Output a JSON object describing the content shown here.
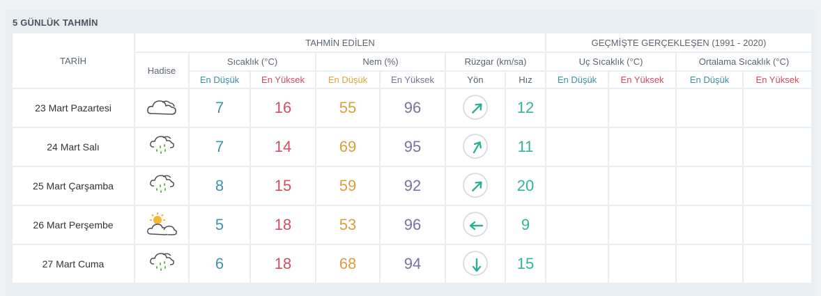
{
  "header": {
    "title": "5 GÜNLÜK TAHMİN"
  },
  "table": {
    "col_date": "TARİH",
    "col_forecast": "TAHMİN EDİLEN",
    "col_past": "GEÇMİŞTE GERÇEKLEŞEN (1991 - 2020)",
    "col_event": "Hadise",
    "col_temp": "Sıcaklık (°C)",
    "col_hum": "Nem (%)",
    "col_wind": "Rüzgar (km/sa)",
    "col_extreme": "Uç Sıcaklık (°C)",
    "col_avg": "Ortalama Sıcaklık (°C)",
    "sub_low": "En Düşük",
    "sub_high": "En Yüksek",
    "sub_dir": "Yön",
    "sub_speed": "Hız"
  },
  "rows": [
    {
      "date": "23 Mart Pazartesi",
      "icon": "cloudy-icon",
      "tmin": "7",
      "tmax": "16",
      "hmin": "55",
      "hmax": "96",
      "wind_dir": "southwest",
      "wind_deg": 225,
      "wind_speed": "12"
    },
    {
      "date": "24 Mart Salı",
      "icon": "rain-icon",
      "tmin": "7",
      "tmax": "14",
      "hmin": "69",
      "hmax": "95",
      "wind_dir": "southwest",
      "wind_deg": 210,
      "wind_speed": "11"
    },
    {
      "date": "25 Mart Çarşamba",
      "icon": "rain-icon",
      "tmin": "8",
      "tmax": "15",
      "hmin": "59",
      "hmax": "92",
      "wind_dir": "southwest",
      "wind_deg": 225,
      "wind_speed": "20"
    },
    {
      "date": "26 Mart Perşembe",
      "icon": "partly-cloudy-icon",
      "tmin": "5",
      "tmax": "18",
      "hmin": "53",
      "hmax": "96",
      "wind_dir": "east",
      "wind_deg": 90,
      "wind_speed": "9"
    },
    {
      "date": "27 Mart Cuma",
      "icon": "rain-icon",
      "tmin": "6",
      "tmax": "18",
      "hmin": "68",
      "hmax": "94",
      "wind_dir": "north",
      "wind_deg": 0,
      "wind_speed": "15"
    }
  ],
  "colors": {
    "low": "#3f93a8",
    "high": "#d64d5f",
    "hum_low": "#d6a040",
    "hum_high": "#7e6fa0",
    "wind": "#33b39a"
  }
}
